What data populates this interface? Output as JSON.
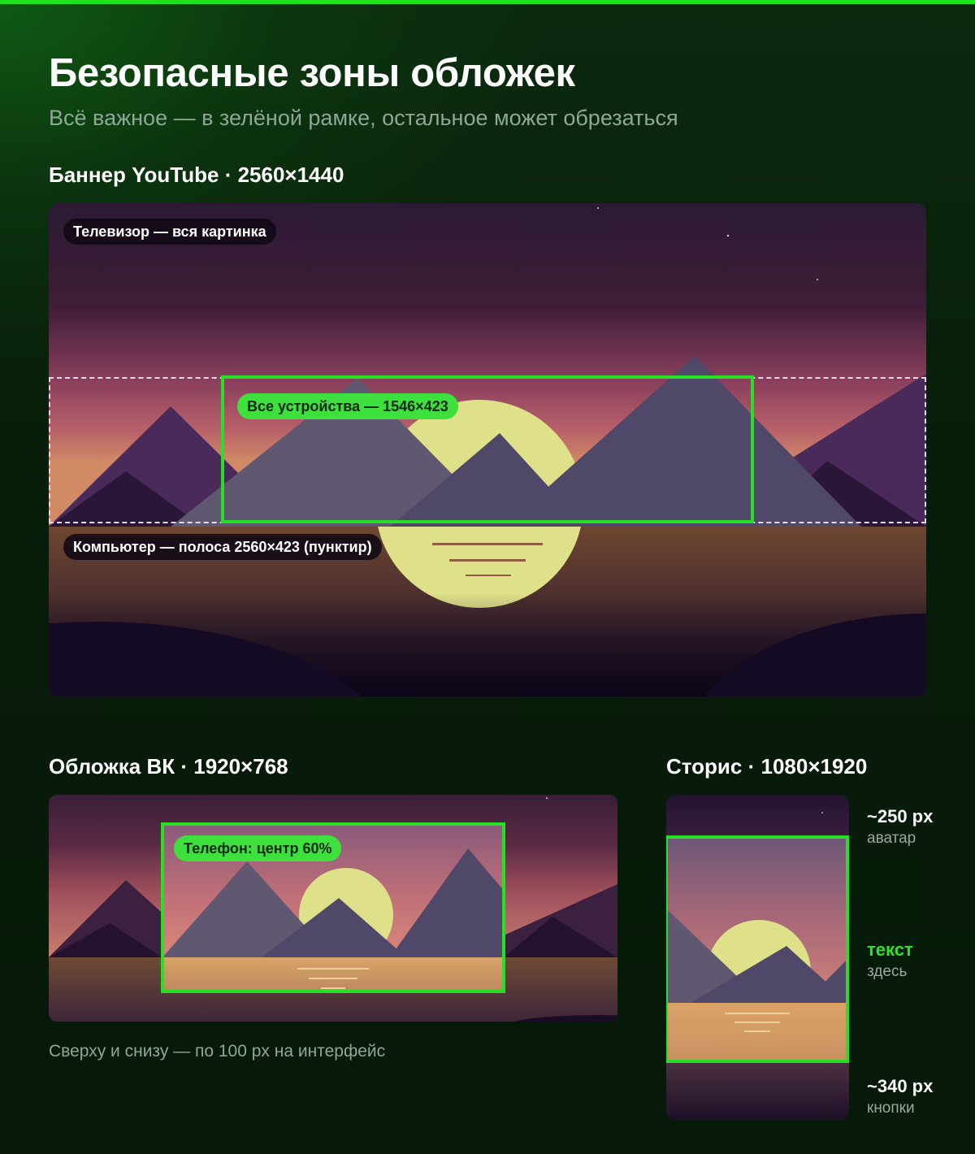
{
  "header": {
    "title": "Безопасные зоны обложек",
    "subtitle": "Всё важное — в зелёной рамке, остальное может обрезаться"
  },
  "youtube": {
    "heading": "Баннер YouTube · 2560×1440",
    "label_tv": "Телевизор — вся картинка",
    "label_all": "Все устройства — 1546×423",
    "label_pc": "Компьютер — полоса 2560×423 (пунктир)"
  },
  "vk": {
    "heading": "Обложка ВК · 1920×768",
    "label_phone": "Телефон: центр 60%",
    "note": "Сверху и снизу — по 100 px на интерфейс"
  },
  "stories": {
    "heading": "Сторис · 1080×1920",
    "top_value": "~250 px",
    "top_label": "аватар",
    "mid_value": "текст",
    "mid_label": "здесь",
    "bottom_value": "~340 px",
    "bottom_label": "кнопки"
  },
  "colors": {
    "accent_green": "#25e025",
    "background": "#081c0a"
  }
}
